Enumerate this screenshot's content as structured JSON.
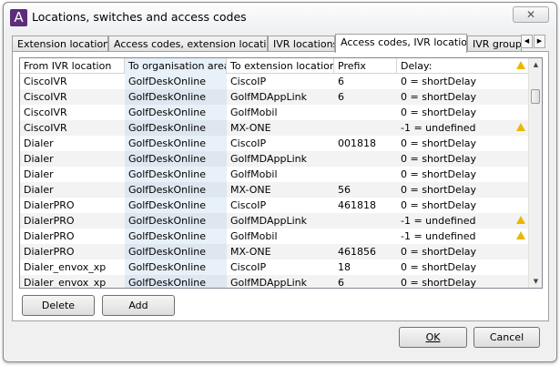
{
  "window": {
    "title": "Locations, switches and access codes",
    "close_label": "✕",
    "logo": "A"
  },
  "tabs": [
    "Extension locations",
    "Access codes, extension locations",
    "IVR locations",
    "Access codes, IVR locations",
    "IVR groups"
  ],
  "active_tab": 3,
  "table": {
    "columns": [
      "From IVR location",
      "To organisation area",
      "To extension location",
      "Prefix",
      "Delay:"
    ],
    "rows": [
      [
        "CiscoIVR",
        "GolfDeskOnline",
        "CiscoIP",
        "6",
        "0 = shortDelay",
        false
      ],
      [
        "CiscoIVR",
        "GolfDeskOnline",
        "GolfMDAppLink",
        "6",
        "0 = shortDelay",
        false
      ],
      [
        "CiscoIVR",
        "GolfDeskOnline",
        "GolfMobil",
        "",
        "0 = shortDelay",
        false
      ],
      [
        "CiscoIVR",
        "GolfDeskOnline",
        "MX-ONE",
        "",
        "-1 = undefined",
        true
      ],
      [
        "Dialer",
        "GolfDeskOnline",
        "CiscoIP",
        "001818",
        "0 = shortDelay",
        false
      ],
      [
        "Dialer",
        "GolfDeskOnline",
        "GolfMDAppLink",
        "",
        "0 = shortDelay",
        false
      ],
      [
        "Dialer",
        "GolfDeskOnline",
        "GolfMobil",
        "",
        "0 = shortDelay",
        false
      ],
      [
        "Dialer",
        "GolfDeskOnline",
        "MX-ONE",
        "56",
        "0 = shortDelay",
        false
      ],
      [
        "DialerPRO",
        "GolfDeskOnline",
        "CiscoIP",
        "461818",
        "0 = shortDelay",
        false
      ],
      [
        "DialerPRO",
        "GolfDeskOnline",
        "GolfMDAppLink",
        "",
        "-1 = undefined",
        true
      ],
      [
        "DialerPRO",
        "GolfDeskOnline",
        "GolfMobil",
        "",
        "-1 = undefined",
        true
      ],
      [
        "DialerPRO",
        "GolfDeskOnline",
        "MX-ONE",
        "461856",
        "0 = shortDelay",
        false
      ],
      [
        "Dialer_envox_xp",
        "GolfDeskOnline",
        "CiscoIP",
        "18",
        "0 = shortDelay",
        false
      ],
      [
        "Dialer_envox_xp",
        "GolfDeskOnline",
        "GolfMDAppLink",
        "6",
        "0 = shortDelay",
        false
      ]
    ]
  },
  "buttons": {
    "delete": "Delete",
    "add": "Add",
    "ok": "OK",
    "cancel": "Cancel"
  }
}
